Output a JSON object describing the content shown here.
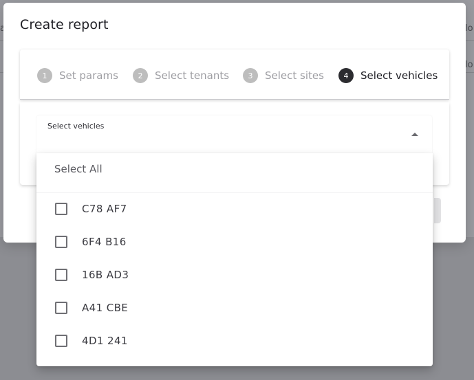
{
  "background": {
    "left_fragment": "a",
    "right_fragment_1": "lo",
    "right_fragment_2": "lo"
  },
  "modal": {
    "title": "Create report"
  },
  "stepper": {
    "steps": [
      {
        "number": "1",
        "label": "Set params",
        "active": false
      },
      {
        "number": "2",
        "label": "Select tenants",
        "active": false
      },
      {
        "number": "3",
        "label": "Select sites",
        "active": false
      },
      {
        "number": "4",
        "label": "Select vehicles",
        "active": true
      }
    ]
  },
  "vehicle_select": {
    "label": "Select vehicles",
    "arrow_icon": "arrow-up-icon"
  },
  "dropdown": {
    "select_all_label": "Select All",
    "options": [
      {
        "label": "C78 AF7",
        "checked": false
      },
      {
        "label": "6F4 B16",
        "checked": false
      },
      {
        "label": "16B AD3",
        "checked": false
      },
      {
        "label": "A41 CBE",
        "checked": false
      },
      {
        "label": "4D1 241",
        "checked": false
      }
    ]
  },
  "colors": {
    "backdrop": "#8c8d92",
    "active_step": "#2c2c30",
    "inactive_step": "#bdbdbd",
    "checkbox_border": "#6f6f74"
  }
}
